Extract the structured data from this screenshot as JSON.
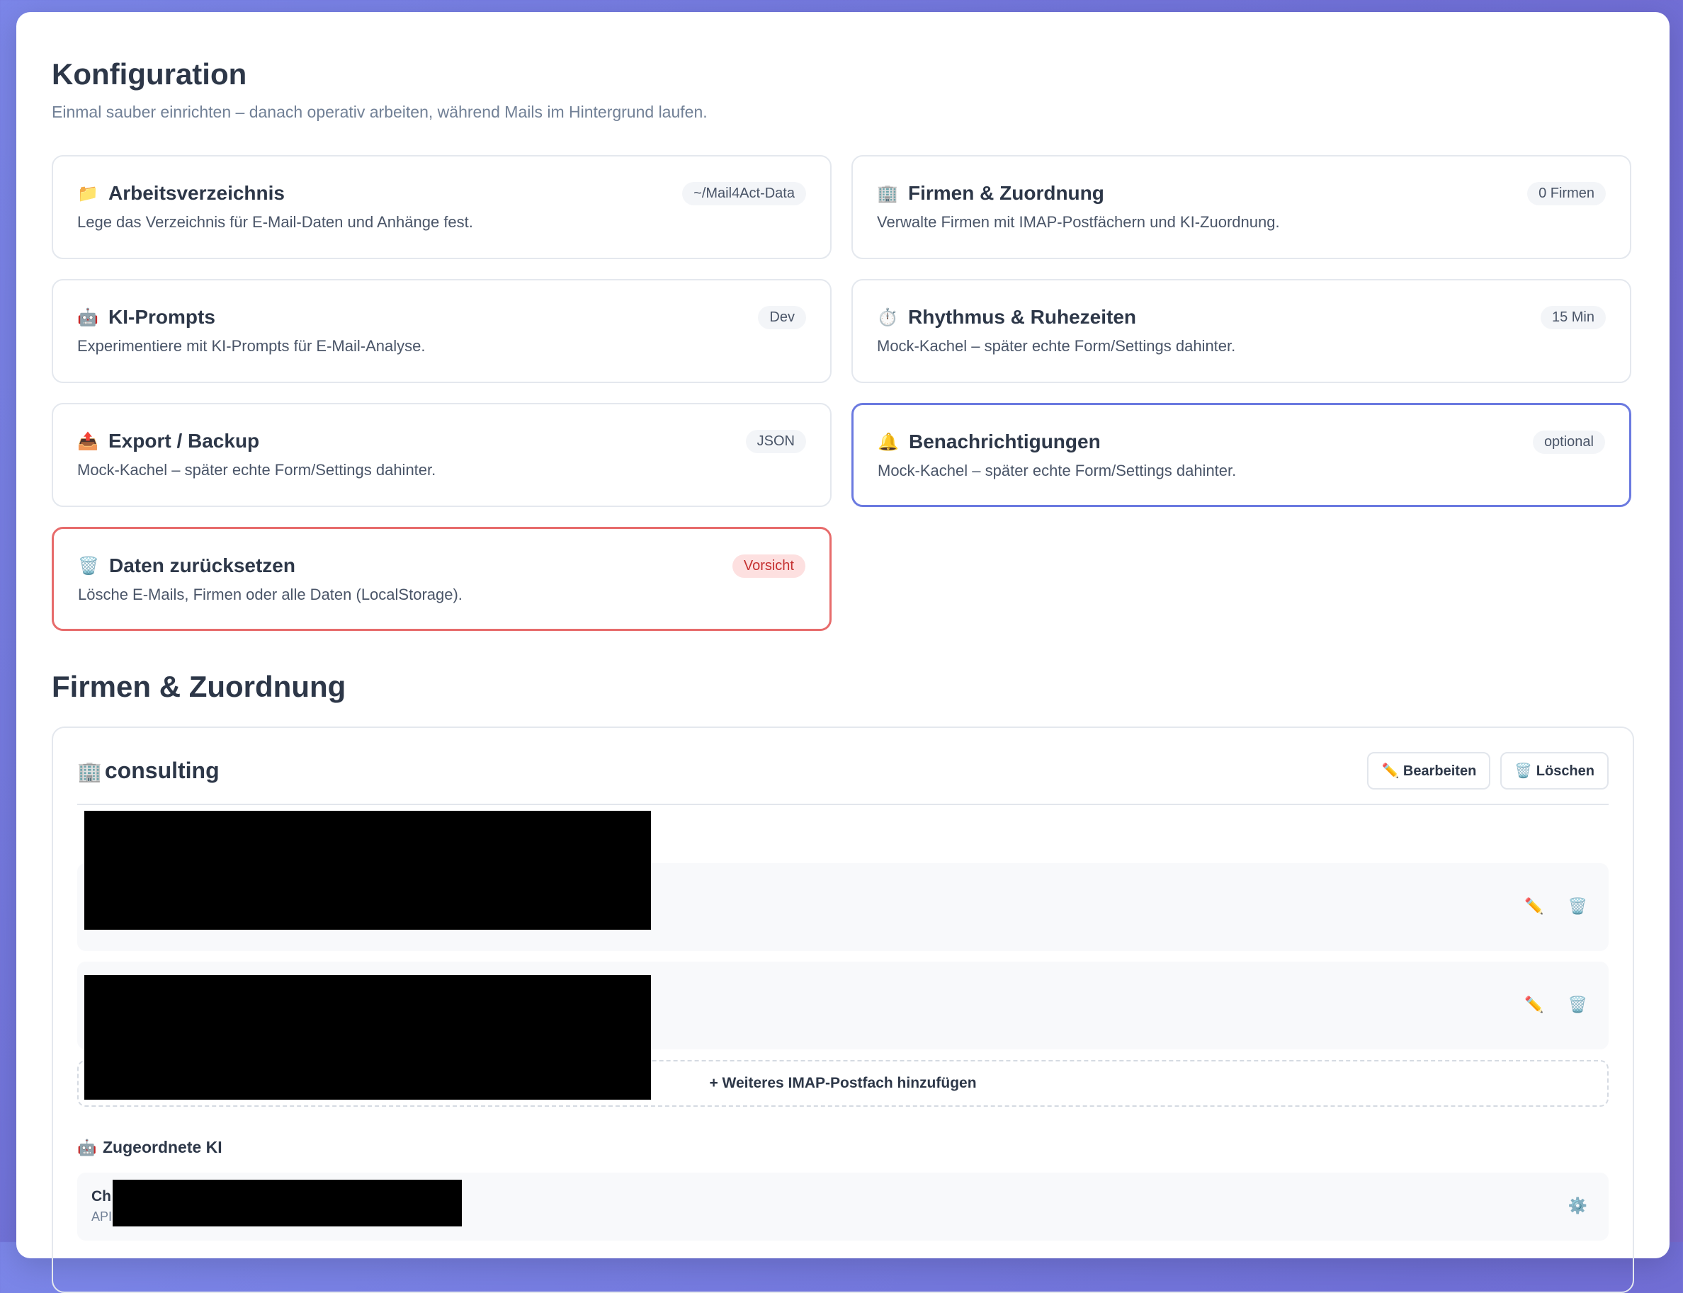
{
  "header": {
    "title": "Konfiguration",
    "subtitle": "Einmal sauber einrichten – danach operativ arbeiten, während Mails im Hintergrund laufen."
  },
  "tiles": [
    {
      "icon": "📁",
      "icon_name": "folder-icon",
      "title": "Arbeitsverzeichnis",
      "badge": "~/Mail4Act-Data",
      "desc": "Lege das Verzeichnis für E-Mail-Daten und Anhänge fest."
    },
    {
      "icon": "🏢",
      "icon_name": "building-icon",
      "title": "Firmen & Zuordnung",
      "badge": "0 Firmen",
      "desc": "Verwalte Firmen mit IMAP-Postfächern und KI-Zuordnung."
    },
    {
      "icon": "🤖",
      "icon_name": "robot-icon",
      "title": "KI-Prompts",
      "badge": "Dev",
      "desc": "Experimentiere mit KI-Prompts für E-Mail-Analyse."
    },
    {
      "icon": "⏱️",
      "icon_name": "stopwatch-icon",
      "title": "Rhythmus & Ruhezeiten",
      "badge": "15 Min",
      "desc": "Mock-Kachel – später echte Form/Settings dahinter."
    },
    {
      "icon": "📤",
      "icon_name": "outbox-icon",
      "title": "Export / Backup",
      "badge": "JSON",
      "desc": "Mock-Kachel – später echte Form/Settings dahinter."
    },
    {
      "icon": "🔔",
      "icon_name": "bell-icon",
      "title": "Benachrichtigungen",
      "badge": "optional",
      "desc": "Mock-Kachel – später echte Form/Settings dahinter."
    },
    {
      "icon": "🗑️",
      "icon_name": "trash-icon",
      "title": "Daten zurücksetzen",
      "badge": "Vorsicht",
      "desc": "Lösche E-Mails, Firmen oder alle Daten (LocalStorage)."
    }
  ],
  "section": {
    "title": "Firmen & Zuordnung"
  },
  "company": {
    "icon": "🏢",
    "name": "consulting",
    "edit_label": "✏️ Bearbeiten",
    "delete_label": "🗑️ Löschen",
    "add_mailbox_label": "+ Weiteres IMAP-Postfach hinzufügen",
    "row_edit_icon": "✏️",
    "row_delete_icon": "🗑️",
    "ki": {
      "icon": "🤖",
      "title": "Zugeordnete KI",
      "name_prefix": "Ch",
      "sub_prefix": "API",
      "settings_icon": "⚙️"
    }
  },
  "colors": {
    "accent": "#6b7ae0",
    "danger": "#e76b6b",
    "background_gradient_start": "#7b86e8"
  }
}
